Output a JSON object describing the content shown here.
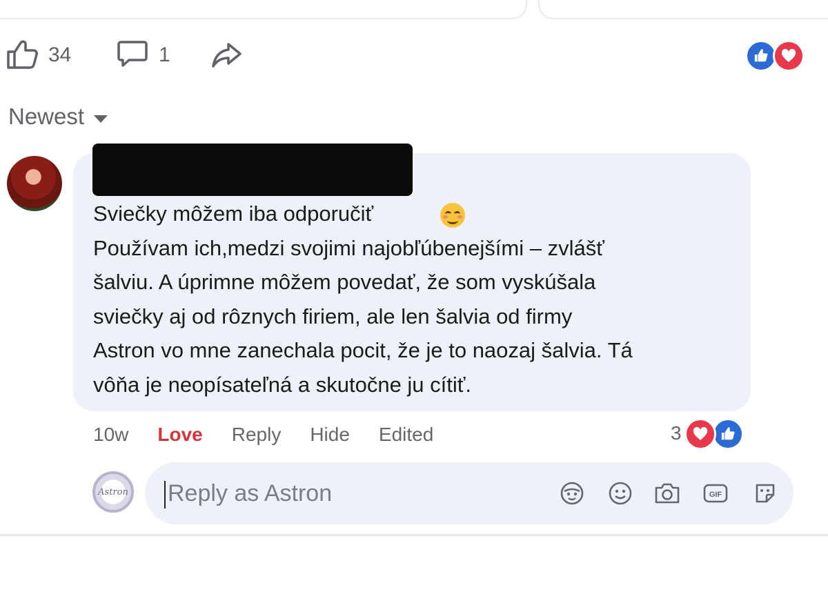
{
  "actions": {
    "like_count": "34",
    "comment_count": "1"
  },
  "sort": {
    "label": "Newest"
  },
  "comment": {
    "text_lines": [
      "Sviečky môžem iba odporučiť",
      "Používam ich,medzi svojimi najobľúbenejšími – zvlášť",
      "šalviu. A úprimne môžem povedať, že som vyskúšala",
      "sviečky aj od rôznych firiem, ale len šalvia od firmy",
      "Astron vo mne zanechala pocit, že je to naozaj šalvia. Tá",
      "vôňa je neopísateľná a skutočne ju cítiť."
    ],
    "meta": {
      "time": "10w",
      "reaction": "Love",
      "reply": "Reply",
      "hide": "Hide",
      "edited": "Edited"
    },
    "reaction_count": "3"
  },
  "reply": {
    "placeholder": "Reply as Astron",
    "avatar_text": "Astron"
  },
  "icons": {
    "action_bar": [
      "thumbs-up-icon",
      "comment-icon",
      "share-icon"
    ],
    "reactions": [
      "like-icon",
      "love-icon"
    ],
    "reply_tools": [
      "avatar-sticker-icon",
      "emoji-icon",
      "camera-icon",
      "gif-icon",
      "sticker-icon"
    ]
  },
  "colors": {
    "like": "#2d6bd4",
    "love": "#e8384c",
    "love_text": "#d2353d"
  }
}
